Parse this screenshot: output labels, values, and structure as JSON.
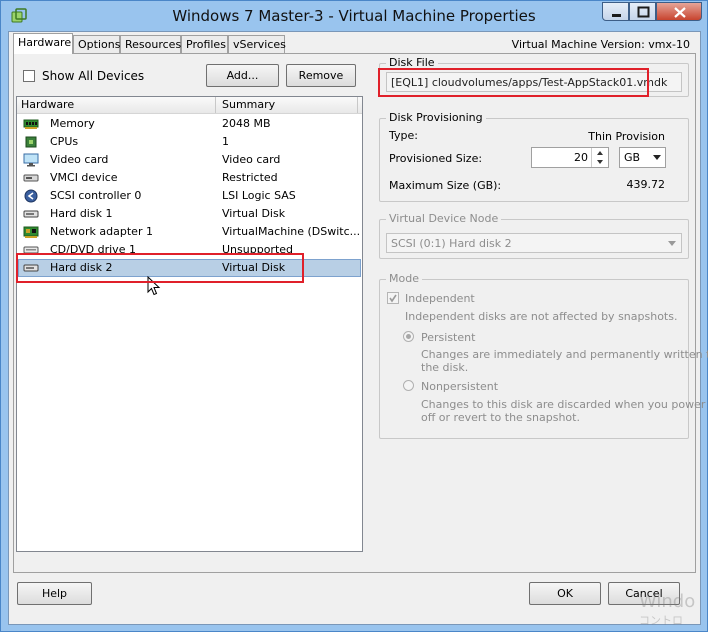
{
  "window": {
    "title": "Windows 7 Master-3 - Virtual Machine Properties",
    "vm_version": "Virtual Machine Version: vmx-10"
  },
  "tabs": [
    {
      "label": "Hardware",
      "active": true
    },
    {
      "label": "Options"
    },
    {
      "label": "Resources"
    },
    {
      "label": "Profiles"
    },
    {
      "label": "vServices"
    }
  ],
  "hardware": {
    "show_all_devices": "Show All Devices",
    "add_label": "Add...",
    "remove_label": "Remove",
    "columns": [
      "Hardware",
      "Summary"
    ],
    "devices": [
      {
        "name": "Memory",
        "summary": "2048 MB",
        "icon": "memory-icon"
      },
      {
        "name": "CPUs",
        "summary": "1",
        "icon": "cpu-icon"
      },
      {
        "name": "Video card",
        "summary": "Video card",
        "icon": "monitor-icon"
      },
      {
        "name": "VMCI device",
        "summary": "Restricted",
        "icon": "vmci-icon"
      },
      {
        "name": "SCSI controller 0",
        "summary": "LSI Logic SAS",
        "icon": "scsi-icon"
      },
      {
        "name": "Hard disk 1",
        "summary": "Virtual Disk",
        "icon": "harddisk-icon"
      },
      {
        "name": "Network adapter 1",
        "summary": "VirtualMachine (DSwitc...",
        "icon": "network-icon"
      },
      {
        "name": "CD/DVD drive 1",
        "summary": "Unsupported",
        "icon": "cdrom-icon"
      },
      {
        "name": "Hard disk 2",
        "summary": "Virtual Disk",
        "icon": "harddisk-icon",
        "selected": true
      }
    ]
  },
  "disk_file": {
    "title": "Disk File",
    "value": "[EQL1] cloudvolumes/apps/Test-AppStack01.vmdk"
  },
  "provisioning": {
    "title": "Disk Provisioning",
    "type_label": "Type:",
    "type_value": "Thin Provision",
    "size_label": "Provisioned Size:",
    "size_value": "20",
    "unit": "GB",
    "max_label": "Maximum Size (GB):",
    "max_value": "439.72"
  },
  "vdn": {
    "title": "Virtual Device Node",
    "value": "SCSI (0:1) Hard disk 2"
  },
  "mode": {
    "title": "Mode",
    "independent": "Independent",
    "independent_desc": "Independent disks are not affected by snapshots.",
    "persistent": "Persistent",
    "persistent_desc_1": "Changes are immediately and permanently written to",
    "persistent_desc_2": "the disk.",
    "nonpersistent": "Nonpersistent",
    "nonpersistent_desc_1": "Changes to this disk are discarded when you power",
    "nonpersistent_desc_2": "off or revert to the snapshot."
  },
  "footer": {
    "help": "Help",
    "ok": "OK",
    "cancel": "Cancel"
  },
  "watermark": {
    "line1": "Windo",
    "line2": "コントロ"
  },
  "colors": {
    "highlight": "#e0202a",
    "selection": "#b8cfe5"
  }
}
